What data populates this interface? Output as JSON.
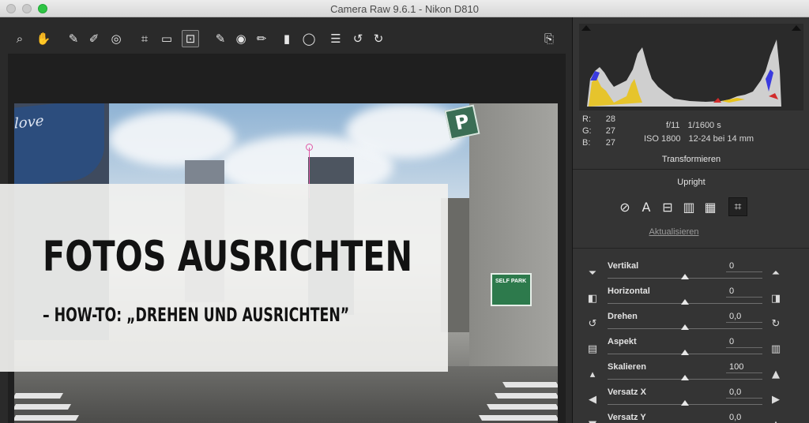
{
  "window": {
    "title": "Camera Raw 9.6.1 - Nikon D810"
  },
  "toolbar": {
    "tools": [
      {
        "icon": "zoom-icon",
        "glyph": "⌕"
      },
      {
        "icon": "hand-icon",
        "glyph": "✋"
      },
      {
        "icon": "white-balance-icon",
        "glyph": "✎"
      },
      {
        "icon": "color-sampler-icon",
        "glyph": "✐"
      },
      {
        "icon": "targeted-adjustment-icon",
        "glyph": "◎"
      },
      {
        "icon": "crop-icon",
        "glyph": "⌗"
      },
      {
        "icon": "straighten-icon",
        "glyph": "▭"
      },
      {
        "icon": "transform-icon",
        "glyph": "⊡"
      },
      {
        "icon": "spot-removal-icon",
        "glyph": "✎"
      },
      {
        "icon": "red-eye-icon",
        "glyph": "◉"
      },
      {
        "icon": "adjustment-brush-icon",
        "glyph": "✏"
      },
      {
        "icon": "graduated-filter-icon",
        "glyph": "▮"
      },
      {
        "icon": "radial-filter-icon",
        "glyph": "◯"
      },
      {
        "icon": "preferences-icon",
        "glyph": "☰"
      },
      {
        "icon": "rotate-left-icon",
        "glyph": "↺"
      },
      {
        "icon": "rotate-right-icon",
        "glyph": "↻"
      }
    ],
    "export_icon": "⎘"
  },
  "overlay": {
    "title": "FOTOS AUSRICHTEN",
    "subtitle": "– HOW-TO: „DREHEN UND AUSRICHTEN”"
  },
  "photo_signs": {
    "p_sign": "P",
    "street_sign": "SELF PARK"
  },
  "panel": {
    "rgb": {
      "r_label": "R:",
      "r": "28",
      "g_label": "G:",
      "g": "27",
      "b_label": "B:",
      "b": "27"
    },
    "exif": {
      "aperture": "f/11",
      "shutter": "1/1600 s",
      "iso": "ISO 1800",
      "lens": "12-24 bei 14 mm"
    },
    "section_title": "Transformieren",
    "upright_label": "Upright",
    "upright_icons": [
      {
        "icon": "upright-off-icon",
        "glyph": "⊘"
      },
      {
        "icon": "upright-auto-icon",
        "glyph": "A"
      },
      {
        "icon": "upright-level-icon",
        "glyph": "⊟"
      },
      {
        "icon": "upright-vertical-icon",
        "glyph": "▥"
      },
      {
        "icon": "upright-full-icon",
        "glyph": "▦"
      },
      {
        "icon": "upright-guided-icon",
        "glyph": "⌗"
      }
    ],
    "update_link": "Aktualisieren",
    "sliders": [
      {
        "label": "Vertikal",
        "value": "0",
        "position": 0.5,
        "icon_left": "vertical-perspective-down-icon",
        "icon_right": "vertical-perspective-up-icon"
      },
      {
        "label": "Horizontal",
        "value": "0",
        "position": 0.5,
        "icon_left": "horizontal-perspective-left-icon",
        "icon_right": "horizontal-perspective-right-icon"
      },
      {
        "label": "Drehen",
        "value": "0,0",
        "position": 0.5,
        "icon_left": "rotate-left-icon",
        "icon_right": "rotate-right-icon"
      },
      {
        "label": "Aspekt",
        "value": "0",
        "position": 0.5,
        "icon_left": "aspect-wide-icon",
        "icon_right": "aspect-tall-icon"
      },
      {
        "label": "Skalieren",
        "value": "100",
        "position": 0.5,
        "icon_left": "scale-small-icon",
        "icon_right": "scale-large-icon"
      },
      {
        "label": "Versatz X",
        "value": "0,0",
        "position": 0.5,
        "icon_left": "arrow-left-icon",
        "icon_right": "arrow-right-icon"
      },
      {
        "label": "Versatz Y",
        "value": "0,0",
        "position": 0.5,
        "icon_left": "arrow-down-icon",
        "icon_right": "arrow-up-icon"
      }
    ]
  }
}
